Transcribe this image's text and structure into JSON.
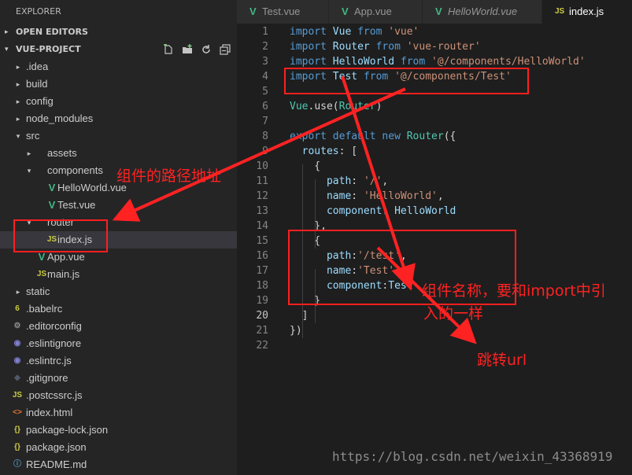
{
  "sidebar": {
    "title": "EXPLORER",
    "open_editors": "OPEN EDITORS",
    "project": "VUE-PROJECT",
    "tree": [
      {
        "label": ".idea",
        "chev": "▸",
        "icon": "folder"
      },
      {
        "label": "build",
        "chev": "▸",
        "icon": "folder"
      },
      {
        "label": "config",
        "chev": "▸",
        "icon": "folder"
      },
      {
        "label": "node_modules",
        "chev": "▸",
        "icon": "folder"
      },
      {
        "label": "src",
        "chev": "▾",
        "icon": "folder"
      },
      {
        "label": "assets",
        "chev": "▸",
        "icon": "folder"
      },
      {
        "label": "components",
        "chev": "▾",
        "icon": "folder"
      },
      {
        "label": "HelloWorld.vue",
        "icon": "vue",
        "glyph": "V"
      },
      {
        "label": "Test.vue",
        "icon": "vue",
        "glyph": "V"
      },
      {
        "label": "router",
        "chev": "▾",
        "icon": "folder"
      },
      {
        "label": "index.js",
        "icon": "js",
        "glyph": "JS"
      },
      {
        "label": "App.vue",
        "icon": "vue",
        "glyph": "V"
      },
      {
        "label": "main.js",
        "icon": "js",
        "glyph": "JS"
      },
      {
        "label": "static",
        "chev": "▸",
        "icon": "folder"
      },
      {
        "label": ".babelrc",
        "icon": "babel",
        "glyph": "6"
      },
      {
        "label": ".editorconfig",
        "icon": "gear",
        "glyph": "⚙"
      },
      {
        "label": ".eslintignore",
        "icon": "eslint",
        "glyph": "◉"
      },
      {
        "label": ".eslintrc.js",
        "icon": "eslint",
        "glyph": "◉"
      },
      {
        "label": ".gitignore",
        "icon": "git",
        "glyph": "◆"
      },
      {
        "label": ".postcssrc.js",
        "icon": "js",
        "glyph": "JS"
      },
      {
        "label": "index.html",
        "icon": "html",
        "glyph": "<>"
      },
      {
        "label": "package-lock.json",
        "icon": "json",
        "glyph": "{}"
      },
      {
        "label": "package.json",
        "icon": "json",
        "glyph": "{}"
      },
      {
        "label": "README.md",
        "icon": "info",
        "glyph": "ⓘ"
      }
    ]
  },
  "tabs": [
    {
      "label": "Test.vue",
      "icon": "vue",
      "glyph": "V"
    },
    {
      "label": "App.vue",
      "icon": "vue",
      "glyph": "V"
    },
    {
      "label": "HelloWorld.vue",
      "icon": "vue",
      "glyph": "V",
      "italic": true
    },
    {
      "label": "index.js",
      "icon": "js",
      "glyph": "JS",
      "active": true
    }
  ],
  "code": {
    "current_line": 20,
    "lines": [
      [
        [
          "kw",
          "import"
        ],
        [
          "p",
          " "
        ],
        [
          "vr",
          "Vue"
        ],
        [
          "p",
          " "
        ],
        [
          "kw",
          "from"
        ],
        [
          "p",
          " "
        ],
        [
          "st",
          "'vue'"
        ]
      ],
      [
        [
          "kw",
          "import"
        ],
        [
          "p",
          " "
        ],
        [
          "vr",
          "Router"
        ],
        [
          "p",
          " "
        ],
        [
          "kw",
          "from"
        ],
        [
          "p",
          " "
        ],
        [
          "st",
          "'vue-router'"
        ]
      ],
      [
        [
          "kw",
          "import"
        ],
        [
          "p",
          " "
        ],
        [
          "vr",
          "HelloWorld"
        ],
        [
          "p",
          " "
        ],
        [
          "kw",
          "from"
        ],
        [
          "p",
          " "
        ],
        [
          "st",
          "'@/components/HelloWorld'"
        ]
      ],
      [
        [
          "kw",
          "import"
        ],
        [
          "p",
          " "
        ],
        [
          "vr",
          "Test"
        ],
        [
          "p",
          " "
        ],
        [
          "kw",
          "from"
        ],
        [
          "p",
          " "
        ],
        [
          "st",
          "'@/components/Test'"
        ]
      ],
      [],
      [
        [
          "cls",
          "Vue"
        ],
        [
          "p",
          "."
        ],
        [
          "p",
          "use"
        ],
        [
          "p",
          "("
        ],
        [
          "cls",
          "Router"
        ],
        [
          "p",
          ")"
        ]
      ],
      [],
      [
        [
          "kw",
          "export"
        ],
        [
          "p",
          " "
        ],
        [
          "kw",
          "default"
        ],
        [
          "p",
          " "
        ],
        [
          "kw",
          "new"
        ],
        [
          "p",
          " "
        ],
        [
          "cls",
          "Router"
        ],
        [
          "p",
          "({"
        ]
      ],
      [
        [
          "p",
          "  "
        ],
        [
          "vr",
          "routes"
        ],
        [
          "p",
          ": ["
        ]
      ],
      [
        [
          "p",
          "    {"
        ]
      ],
      [
        [
          "p",
          "      "
        ],
        [
          "vr",
          "path"
        ],
        [
          "p",
          ": "
        ],
        [
          "st",
          "'/'"
        ],
        [
          "p",
          ","
        ]
      ],
      [
        [
          "p",
          "      "
        ],
        [
          "vr",
          "name"
        ],
        [
          "p",
          ": "
        ],
        [
          "st",
          "'HelloWorld'"
        ],
        [
          "p",
          ","
        ]
      ],
      [
        [
          "p",
          "      "
        ],
        [
          "vr",
          "component"
        ],
        [
          "p",
          ": "
        ],
        [
          "vr",
          "HelloWorld"
        ]
      ],
      [
        [
          "p",
          "    },"
        ]
      ],
      [
        [
          "p",
          "    {"
        ]
      ],
      [
        [
          "p",
          "      "
        ],
        [
          "vr",
          "path"
        ],
        [
          "p",
          ":"
        ],
        [
          "st",
          "'/test'"
        ],
        [
          "p",
          ","
        ]
      ],
      [
        [
          "p",
          "      "
        ],
        [
          "vr",
          "name"
        ],
        [
          "p",
          ":"
        ],
        [
          "st",
          "'Test'"
        ],
        [
          "p",
          ","
        ]
      ],
      [
        [
          "p",
          "      "
        ],
        [
          "vr",
          "component"
        ],
        [
          "p",
          ":"
        ],
        [
          "vr",
          "Test"
        ]
      ],
      [
        [
          "p",
          "    }"
        ]
      ],
      [
        [
          "p",
          "  ]"
        ]
      ],
      [
        [
          "p",
          "})"
        ]
      ],
      []
    ]
  },
  "annotations": {
    "path_note": "组件的路径地址",
    "name_note_line1": "组件名称，要和import中引",
    "name_note_line2": "入的一样",
    "url_note": "跳转url"
  },
  "watermark": "https://blog.csdn.net/weixin_43368919",
  "colors": {
    "annotation_red": "#ff2222",
    "vue_green": "#41b883",
    "js_yellow": "#cbcb41",
    "editor_bg": "#1e1e1e",
    "sidebar_bg": "#252526"
  }
}
